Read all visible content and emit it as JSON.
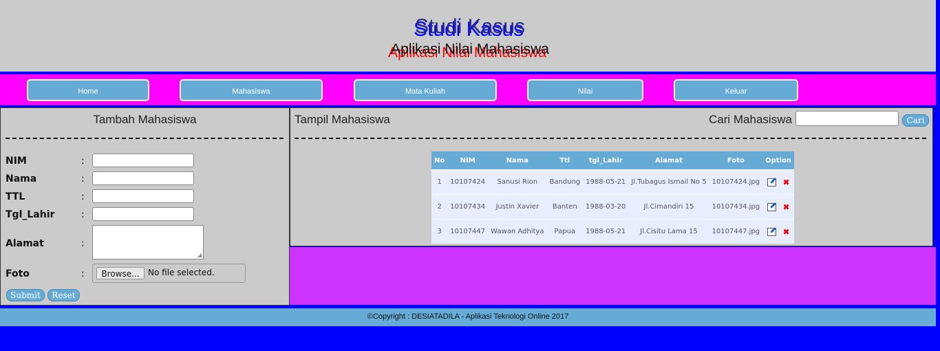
{
  "header": {
    "title": "Studi Kasus",
    "subtitle": "Aplikasi Nilai Mahasiswa"
  },
  "nav": {
    "items": [
      "Home",
      "Mahasiswa",
      "Mata Kuliah",
      "Nilai",
      "Keluar"
    ]
  },
  "form": {
    "title": "Tambah Mahasiswa",
    "labels": [
      "NIM",
      "Nama",
      "TTL",
      "Tgl_Lahir",
      "Alamat",
      "Foto"
    ],
    "colon": ":",
    "file_button": "Browse...",
    "file_status": "No file selected.",
    "submit": "Submit",
    "reset": "Reset"
  },
  "list": {
    "title": "Tampil Mahasiswa",
    "search_label": "Cari Mahasiswa",
    "search_button": "Cari",
    "columns": [
      "No",
      "NIM",
      "Nama",
      "Ttl",
      "tgl_Lahir",
      "Alamat",
      "Foto",
      "Option"
    ],
    "rows": [
      [
        "1",
        "10107424",
        "Sanusi Rion",
        "Bandung",
        "1988-05-21",
        "Jl.Tubagus Ismail No 5",
        "10107424.jpg"
      ],
      [
        "2",
        "10107434",
        "Justin Xavier",
        "Banten",
        "1988-03-20",
        "Jl.Cimandiri 15",
        "10107434.jpg"
      ],
      [
        "3",
        "10107447",
        "Wawan Adhitya",
        "Papua",
        "1988-05-21",
        "Jl.Cisitu Lama 15",
        "10107447.jpg"
      ]
    ]
  },
  "footer": {
    "text": "©Copyright : DESIATADILA - Aplikasi Teknologi Online 2017"
  },
  "colors": {
    "background": "#0000ff",
    "panel": "#cbcbcb",
    "navbar": "#ff00ff",
    "accent": "#66aad6",
    "fill": "#cc33ff"
  }
}
